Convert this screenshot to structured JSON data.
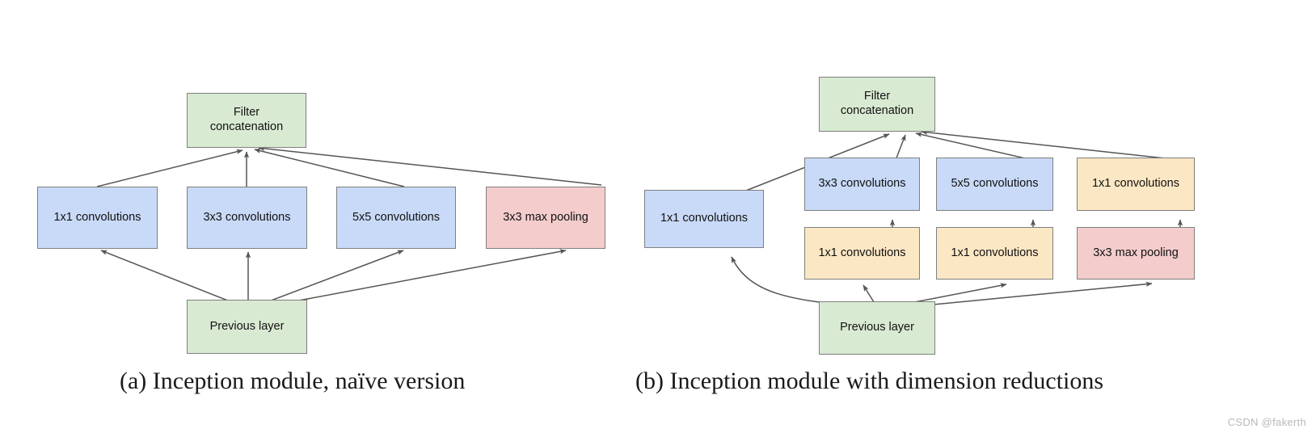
{
  "figure": {
    "watermark": "CSDN @fakerth",
    "colors": {
      "green": "#d9ead3",
      "blue": "#c9daf8",
      "pink": "#f4cccc",
      "yellow": "#fce7c4",
      "stroke": "#7f7f7f",
      "arrow": "#555555",
      "text": "#111111",
      "background": "#ffffff"
    },
    "panels": [
      {
        "id": "a",
        "caption": "(a)  Inception module, naïve version",
        "nodes": [
          {
            "label": "Filter\nconcatenation",
            "color": "green"
          },
          {
            "label": "1x1 convolutions",
            "color": "blue"
          },
          {
            "label": "3x3 convolutions",
            "color": "blue"
          },
          {
            "label": "5x5 convolutions",
            "color": "blue"
          },
          {
            "label": "3x3 max pooling",
            "color": "pink"
          },
          {
            "label": "Previous layer",
            "color": "green"
          }
        ]
      },
      {
        "id": "b",
        "caption": "(b)  Inception module with dimension reductions",
        "nodes": [
          {
            "label": "Filter\nconcatenation",
            "color": "green"
          },
          {
            "label": "1x1 convolutions",
            "color": "blue"
          },
          {
            "label": "3x3 convolutions",
            "color": "blue"
          },
          {
            "label": "5x5 convolutions",
            "color": "blue"
          },
          {
            "label": "1x1 convolutions",
            "color": "yellow"
          },
          {
            "label": "1x1 convolutions",
            "color": "yellow"
          },
          {
            "label": "1x1 convolutions",
            "color": "yellow"
          },
          {
            "label": "3x3 max pooling",
            "color": "pink"
          },
          {
            "label": "Previous layer",
            "color": "green"
          }
        ]
      }
    ]
  }
}
